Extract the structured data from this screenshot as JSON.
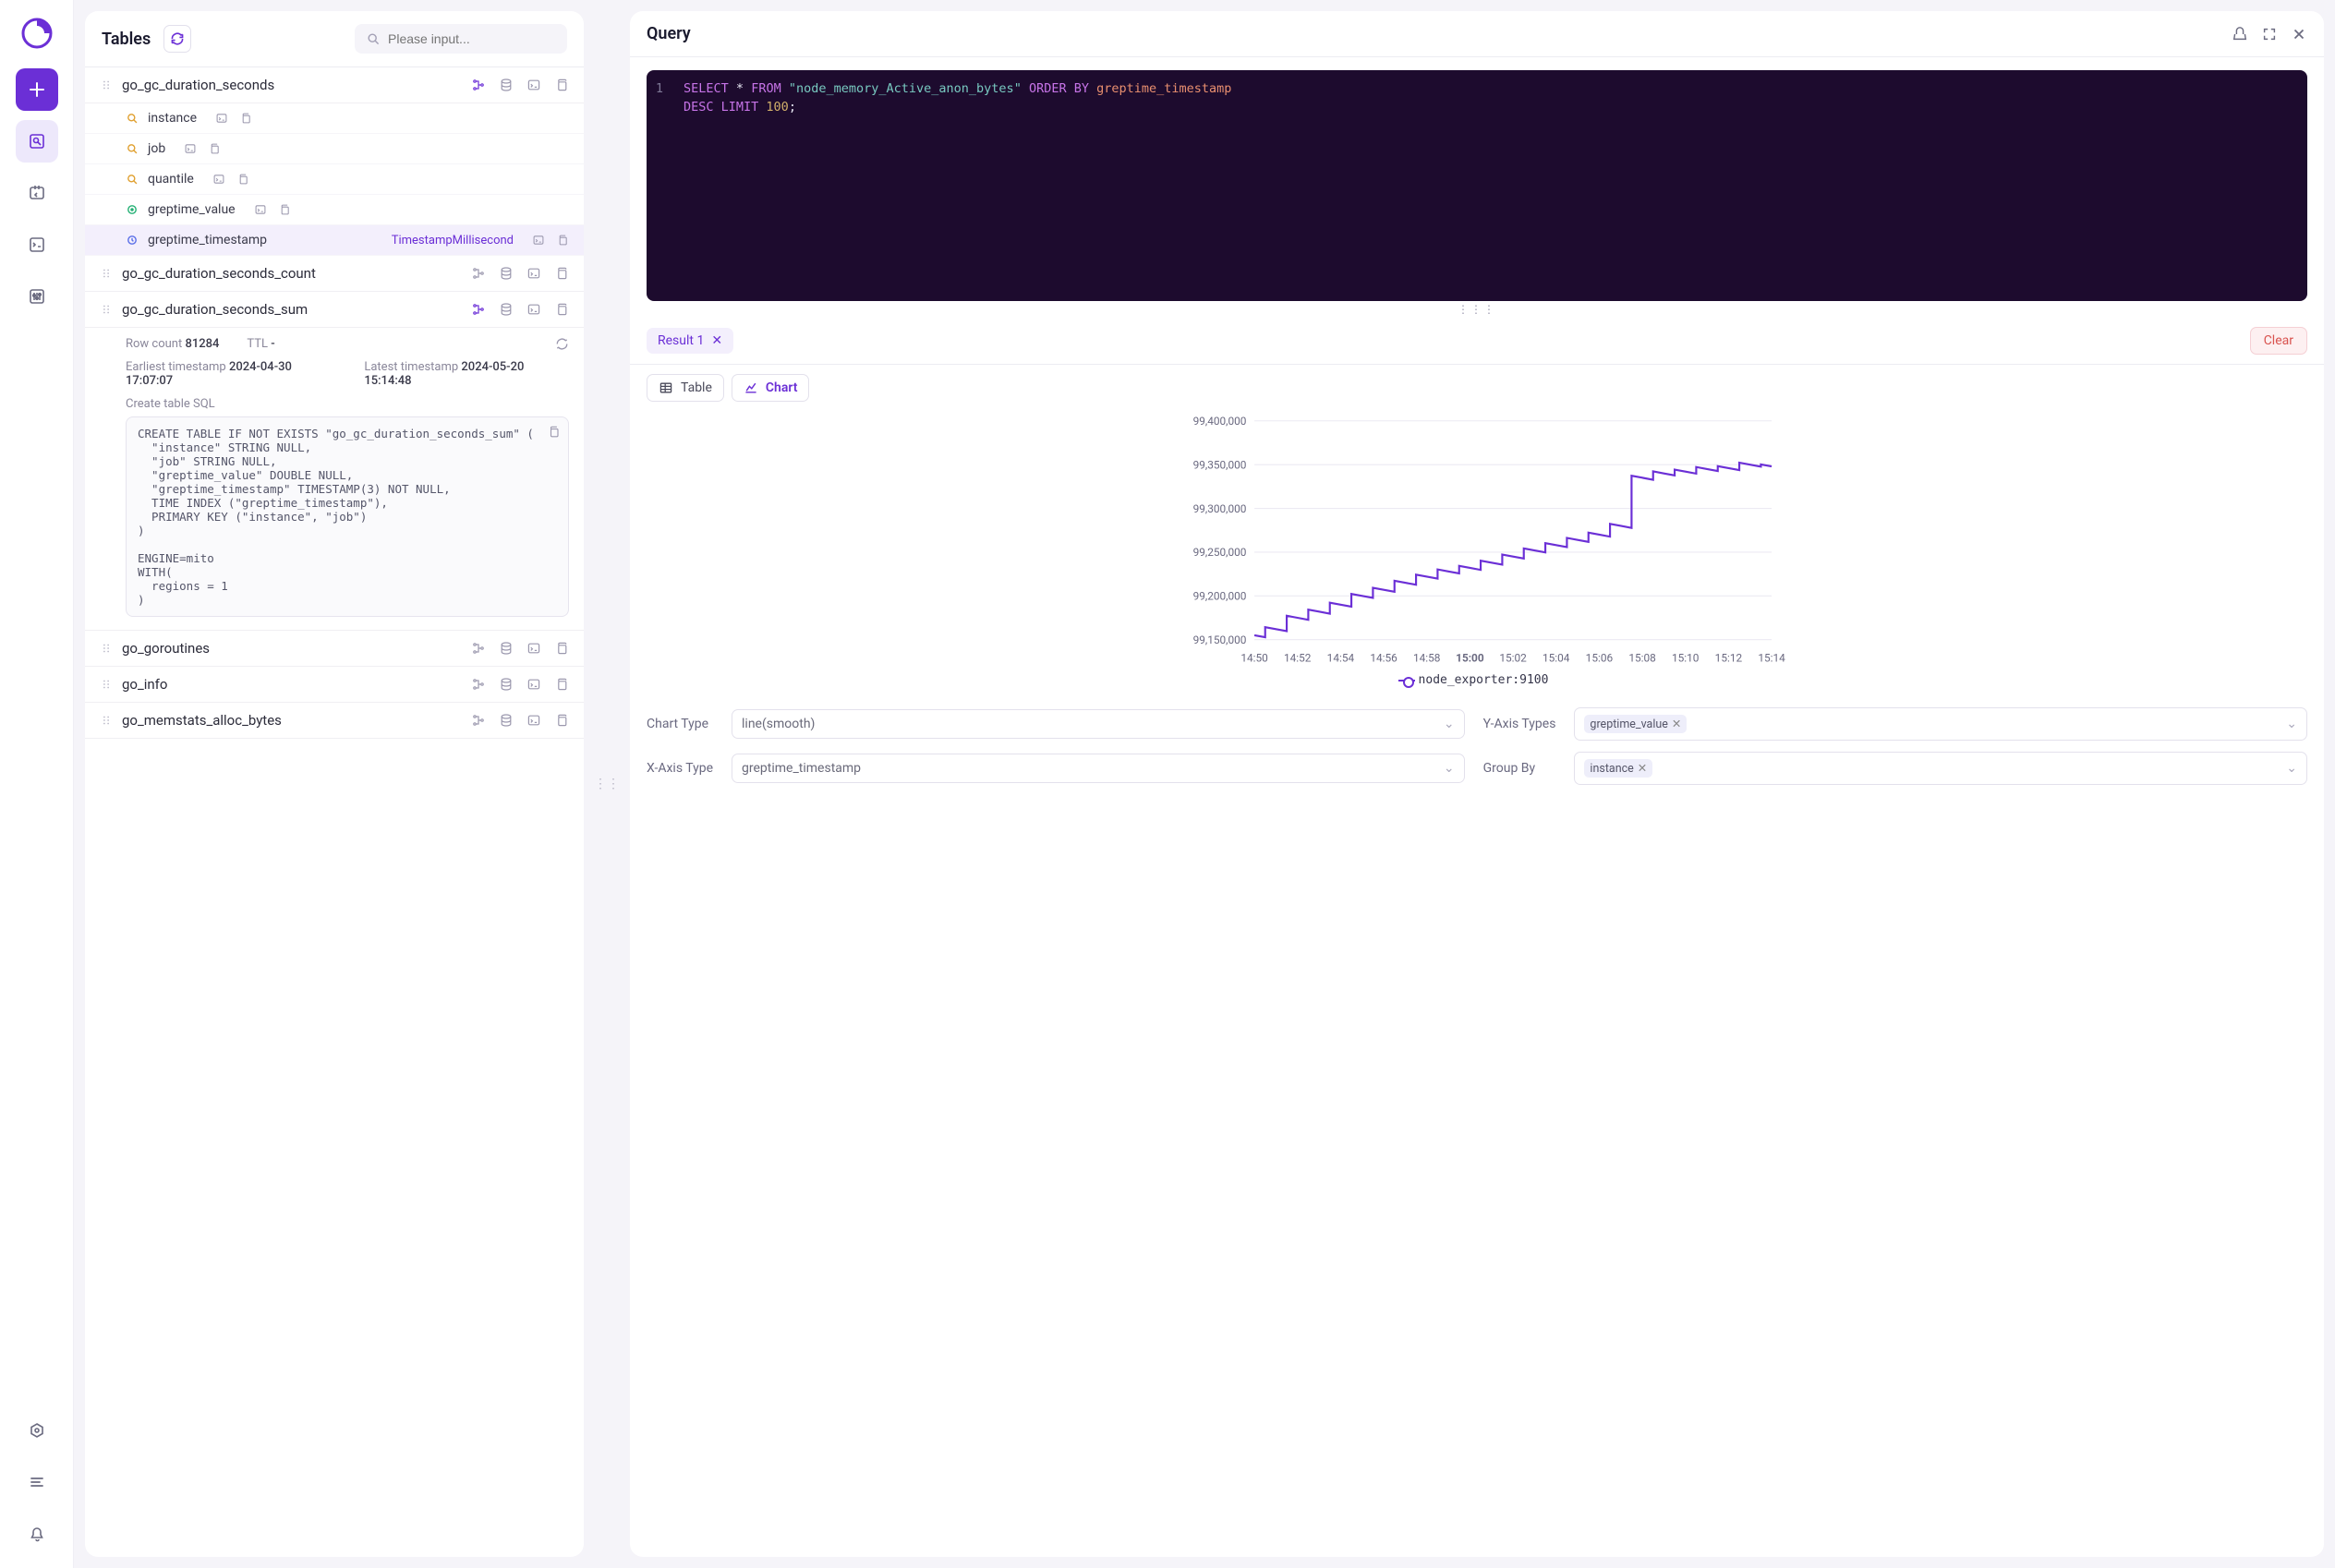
{
  "sidebar": {
    "nav": [
      "plus",
      "query",
      "ingest",
      "runbook",
      "tuning"
    ],
    "bottom": [
      "settings",
      "menu",
      "notifications"
    ]
  },
  "tables_panel": {
    "title": "Tables",
    "search_placeholder": "Please input...",
    "tables": [
      {
        "name": "go_gc_duration_seconds",
        "columns": [
          {
            "icon": "search",
            "name": "instance"
          },
          {
            "icon": "search",
            "name": "job"
          },
          {
            "icon": "search",
            "name": "quantile"
          },
          {
            "icon": "dot",
            "name": "greptime_value"
          },
          {
            "icon": "clock",
            "name": "greptime_timestamp",
            "type": "TimestampMillisecond",
            "selected": true
          }
        ]
      },
      {
        "name": "go_gc_duration_seconds_count"
      },
      {
        "name": "go_gc_duration_seconds_sum",
        "expanded": true,
        "details": {
          "row_count_label": "Row count",
          "row_count": "81284",
          "ttl_label": "TTL",
          "ttl": "-",
          "earliest_label": "Earliest timestamp",
          "earliest": "2024-04-30 17:07:07",
          "latest_label": "Latest timestamp",
          "latest": "2024-05-20 15:14:48",
          "sql_label": "Create table SQL",
          "sql": "CREATE TABLE IF NOT EXISTS \"go_gc_duration_seconds_sum\" (\n  \"instance\" STRING NULL,\n  \"job\" STRING NULL,\n  \"greptime_value\" DOUBLE NULL,\n  \"greptime_timestamp\" TIMESTAMP(3) NOT NULL,\n  TIME INDEX (\"greptime_timestamp\"),\n  PRIMARY KEY (\"instance\", \"job\")\n)\n\nENGINE=mito\nWITH(\n  regions = 1\n)"
        }
      },
      {
        "name": "go_goroutines"
      },
      {
        "name": "go_info"
      },
      {
        "name": "go_memstats_alloc_bytes"
      }
    ]
  },
  "query_panel": {
    "title": "Query",
    "line_no": "1",
    "sql_kw1": "SELECT",
    "sql_star": "*",
    "sql_kw2": "FROM",
    "sql_table": "\"node_memory_Active_anon_bytes\"",
    "sql_kw3": "ORDER BY",
    "sql_col": "greptime_timestamp",
    "sql_kw4": "DESC LIMIT",
    "sql_num": "100",
    "sql_semi": ";",
    "result_tab": "Result 1",
    "clear": "Clear",
    "table_btn": "Table",
    "chart_btn": "Chart",
    "legend": "node_exporter:9100",
    "controls": {
      "chart_type_label": "Chart Type",
      "chart_type": "line(smooth)",
      "yaxis_label": "Y-Axis Types",
      "yaxis_chip": "greptime_value",
      "xaxis_label": "X-Axis Type",
      "xaxis": "greptime_timestamp",
      "groupby_label": "Group By",
      "groupby_chip": "instance"
    }
  },
  "chart_data": {
    "type": "line",
    "title": "",
    "xlabel": "",
    "ylabel": "",
    "ylim": [
      99150000,
      99400000
    ],
    "x_ticks": [
      "14:50",
      "14:52",
      "14:54",
      "14:56",
      "14:58",
      "15:00",
      "15:02",
      "15:04",
      "15:06",
      "15:08",
      "15:10",
      "15:12",
      "15:14"
    ],
    "y_ticks": [
      "99,150,000",
      "99,200,000",
      "99,250,000",
      "99,300,000",
      "99,350,000",
      "99,400,000"
    ],
    "series": [
      {
        "name": "node_exporter:9100",
        "x": [
          "14:50",
          "14:51",
          "14:52",
          "14:53",
          "14:54",
          "14:55",
          "14:56",
          "14:57",
          "14:58",
          "14:59",
          "15:00",
          "15:01",
          "15:02",
          "15:03",
          "15:04",
          "15:05",
          "15:06",
          "15:07",
          "15:08",
          "15:09",
          "15:10",
          "15:11",
          "15:12",
          "15:13",
          "15:14"
        ],
        "values": [
          99155000,
          99162000,
          99175000,
          99182000,
          99190000,
          99200000,
          99207000,
          99215000,
          99222000,
          99228000,
          99232000,
          99238000,
          99245000,
          99252000,
          99258000,
          99264000,
          99270000,
          99280000,
          99335000,
          99340000,
          99342000,
          99345000,
          99346000,
          99350000,
          99348000
        ]
      }
    ]
  }
}
